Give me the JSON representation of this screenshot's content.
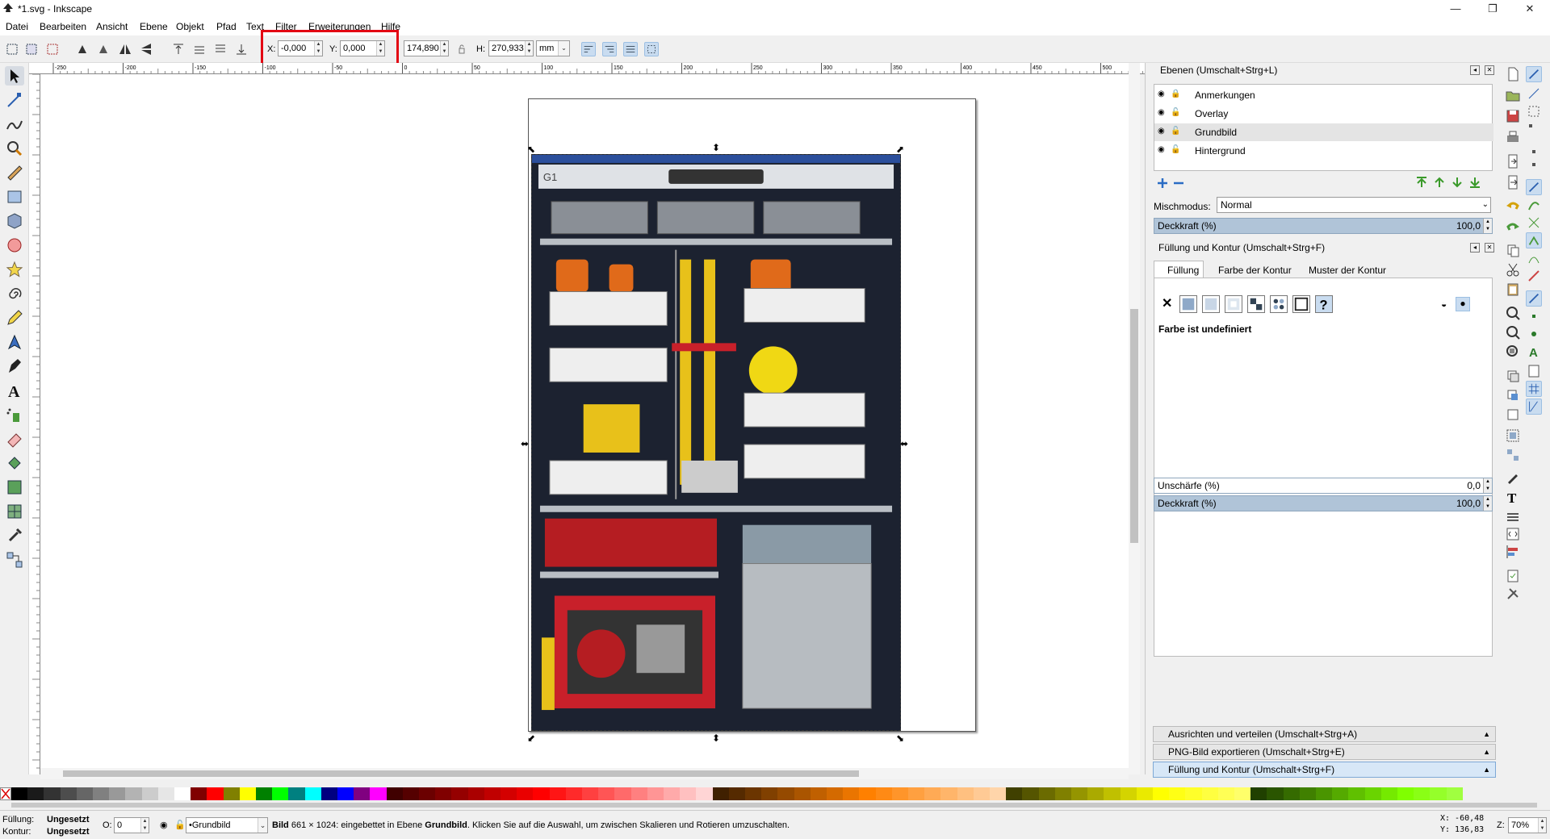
{
  "window": {
    "title": "*1.svg - Inkscape",
    "minimize": "—",
    "maximize": "❐",
    "close": "✕"
  },
  "menu": [
    "Datei",
    "Bearbeiten",
    "Ansicht",
    "Ebene",
    "Objekt",
    "Pfad",
    "Text",
    "Filter",
    "Erweiterungen",
    "Hilfe"
  ],
  "toolbar": {
    "x_label": "X:",
    "x_value": "-0,000",
    "y_label": "Y:",
    "y_value": "0,000",
    "w_value": "174,890",
    "h_label": "H:",
    "h_value": "270,933",
    "unit": "mm"
  },
  "ruler_labels": [
    "-250",
    "-200",
    "-150",
    "-100",
    "-50",
    "0",
    "50",
    "100",
    "150",
    "200",
    "250",
    "300",
    "350",
    "400",
    "450",
    "500"
  ],
  "canvas": {
    "image_label": "G1"
  },
  "layers_panel": {
    "title": "Ebenen (Umschalt+Strg+L)",
    "layers": [
      "Anmerkungen",
      "Overlay",
      "Grundbild",
      "Hintergrund"
    ],
    "blend_label": "Mischmodus:",
    "blend_value": "Normal",
    "opacity_label": "Deckkraft (%)",
    "opacity_value": "100,0"
  },
  "fill_panel": {
    "title": "Füllung und Kontur (Umschalt+Strg+F)",
    "tabs": [
      "Füllung",
      "Farbe der Kontur",
      "Muster der Kontur"
    ],
    "undefined_text": "Farbe ist undefiniert",
    "blur_label": "Unschärfe (%)",
    "blur_value": "0,0",
    "opacity_label": "Deckkraft (%)",
    "opacity_value": "100,0"
  },
  "folded_panels": [
    "Ausrichten und verteilen (Umschalt+Strg+A)",
    "PNG-Bild exportieren (Umschalt+Strg+E)",
    "Füllung und Kontur (Umschalt+Strg+F)"
  ],
  "status": {
    "fill_label": "Füllung:",
    "fill_value": "Ungesetzt",
    "stroke_label": "Kontur:",
    "stroke_value": "Ungesetzt",
    "o_label": "O:",
    "o_value": "0",
    "layer_select": "Grundbild",
    "message_bold": "Bild",
    "message": "661 × 1024: eingebettet in Ebene",
    "message_layer": "Grundbild",
    "message_tail": ". Klicken Sie auf die Auswahl, um zwischen Skalieren und Rotieren umzuschalten.",
    "cursor_x": "X: -60,48",
    "cursor_y": "Y: 136,83",
    "zoom_label": "Z:",
    "zoom_value": "70%"
  },
  "colors": {
    "accent_red": "#e30613",
    "selection_blue": "#c9dcf0",
    "truck_blue": "#2b4f9c"
  }
}
